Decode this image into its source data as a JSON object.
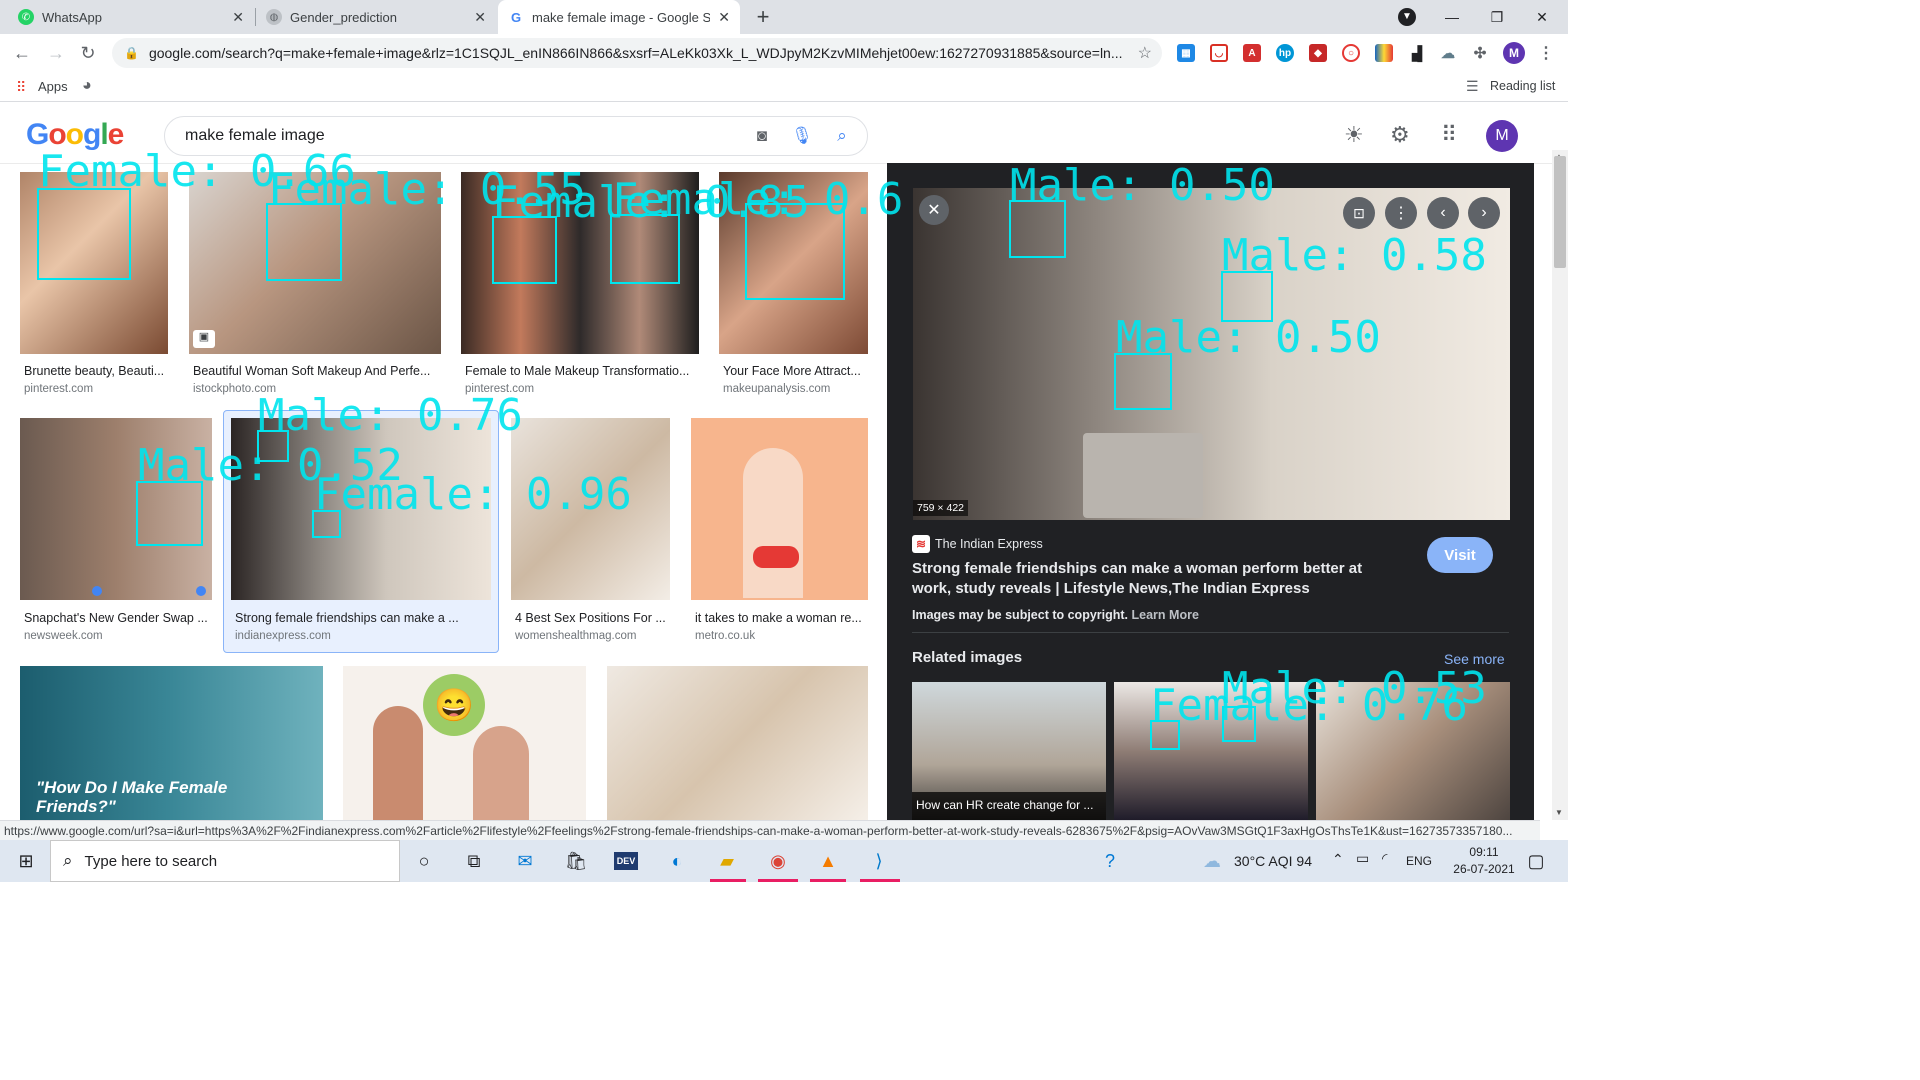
{
  "browser": {
    "tabs": [
      {
        "title": "WhatsApp"
      },
      {
        "title": "Gender_prediction"
      },
      {
        "title": "make female image - Google Search"
      }
    ],
    "url": "google.com/search?q=make+female+image&rlz=1C1SQJL_enIN866IN866&sxsrf=ALeKk03Xk_L_WDJpyM2KzvMIMehjet00ew:1627270931885&source=ln...",
    "bookmarks": {
      "apps_label": "Apps",
      "reading_list": "Reading list"
    },
    "profile_initial": "M"
  },
  "search": {
    "query": "make female image",
    "logo_text": "Google"
  },
  "results": [
    {
      "caption": "Brunette beauty, Beauti...",
      "source": "pinterest.com"
    },
    {
      "caption": "Beautiful Woman Soft Makeup And Perfe...",
      "source": "istockphoto.com"
    },
    {
      "caption": "Female to Male Makeup Transformatio...",
      "source": "pinterest.com"
    },
    {
      "caption": "Your Face More Attract...",
      "source": "makeupanalysis.com"
    },
    {
      "caption": "Snapchat's New Gender Swap ...",
      "source": "newsweek.com"
    },
    {
      "caption": "Strong female friendships can make a ...",
      "source": "indianexpress.com"
    },
    {
      "caption": "4 Best Sex Positions For ...",
      "source": "womenshealthmag.com"
    },
    {
      "caption": "it takes to make a woman re...",
      "source": "metro.co.uk"
    },
    {
      "caption": "\"How Do I Make Female Friends?\"",
      "source": ""
    }
  ],
  "panel": {
    "dimensions": "759 × 422",
    "publisher": "The Indian Express",
    "title": "Strong female friendships can make a woman perform better at work, study reveals | Lifestyle News,The Indian Express",
    "copyright": "Images may be subject to copyright.",
    "learn_more": "Learn More",
    "visit": "Visit",
    "related_heading": "Related images",
    "see_more": "See more",
    "related_caption": "How can HR create change for ..."
  },
  "overlays": {
    "l1": "Female: 0.66",
    "l2": "Female: 0.55",
    "l3": "Female: 0.85",
    "l4": "Female: 0.6",
    "l5": "Male: 0.50",
    "l6": "Male: 0.58",
    "l7": "Male: 0.50",
    "l8": "Male: 0.76",
    "l9": "Male: 0.52",
    "l10": "Female: 0.96",
    "l11": "Male: 0.53",
    "l12": "Female: 0.76"
  },
  "status_url": "https://www.google.com/url?sa=i&url=https%3A%2F%2Findianexpress.com%2Farticle%2Flifestyle%2Ffeelings%2Fstrong-female-friendships-can-make-a-woman-perform-better-at-work-study-reveals-6283675%2F&psig=AOvVaw3MSGtQ1F3axHgOsThsTe1K&ust=16273573357180...",
  "taskbar": {
    "search_placeholder": "Type here to search",
    "weather": "30°C AQI 94",
    "lang": "ENG",
    "time": "09:11",
    "date": "26-07-2021"
  }
}
